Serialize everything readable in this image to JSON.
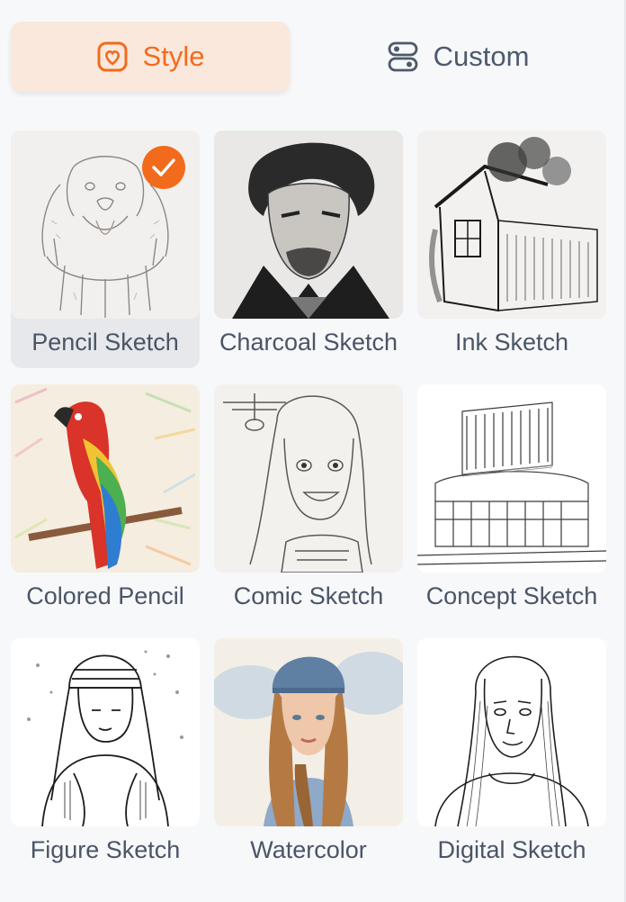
{
  "tabs": [
    {
      "label": "Style",
      "icon": "heart-frame-icon",
      "selected": true
    },
    {
      "label": "Custom",
      "icon": "toggle-sliders-icon",
      "selected": false
    }
  ],
  "colors": {
    "accent": "#f26b1d",
    "tab_selected_bg": "#fbe8dc",
    "card_selected_bg": "#e6e8eb",
    "label_text": "#4a5566"
  },
  "styles": [
    {
      "label": "Pencil Sketch",
      "selected": true
    },
    {
      "label": "Charcoal Sketch",
      "selected": false
    },
    {
      "label": "Ink Sketch",
      "selected": false
    },
    {
      "label": "Colored Pencil",
      "selected": false
    },
    {
      "label": "Comic Sketch",
      "selected": false
    },
    {
      "label": "Concept Sketch",
      "selected": false
    },
    {
      "label": "Figure Sketch",
      "selected": false
    },
    {
      "label": "Watercolor",
      "selected": false
    },
    {
      "label": "Digital Sketch",
      "selected": false
    }
  ]
}
